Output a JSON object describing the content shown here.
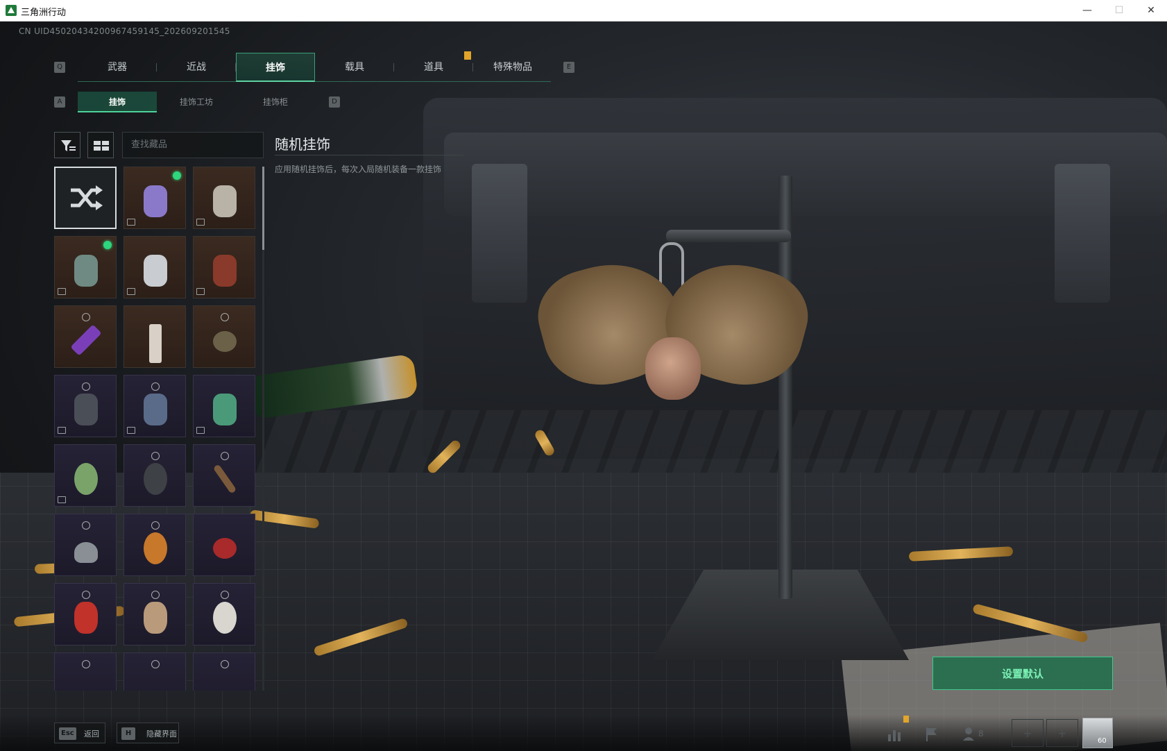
{
  "window": {
    "title": "三角洲行动",
    "minimize": "—",
    "maximize": "☐",
    "close": "✕"
  },
  "uid": "CN UID450204342009674591​45_202609201545",
  "tabs": {
    "prev_key": "Q",
    "next_key": "E",
    "items": [
      {
        "label": "武器"
      },
      {
        "label": "近战"
      },
      {
        "label": "挂饰",
        "active": true
      },
      {
        "label": "载具"
      },
      {
        "label": "道具"
      },
      {
        "label": "特殊物品"
      }
    ]
  },
  "subtabs": {
    "prev_key": "A",
    "next_key": "D",
    "items": [
      {
        "label": "挂饰",
        "active": true
      },
      {
        "label": "挂饰工坊"
      },
      {
        "label": "挂饰柜"
      }
    ]
  },
  "search": {
    "placeholder": "查找藏品"
  },
  "detail": {
    "title": "随机挂饰",
    "description": "应用随机挂饰后，每次入局随机装备一款挂饰"
  },
  "actions": {
    "set_default": "设置默认"
  },
  "hotkeys": [
    {
      "key": "Esc",
      "label": "返回"
    },
    {
      "key": "H",
      "label": "隐藏界面"
    }
  ],
  "hud": {
    "friends_count": "8",
    "level": "60"
  },
  "colors": {
    "accent": "#3fc98c",
    "equipped_dot": "#2ed67d",
    "marker": "#e2a52b"
  }
}
